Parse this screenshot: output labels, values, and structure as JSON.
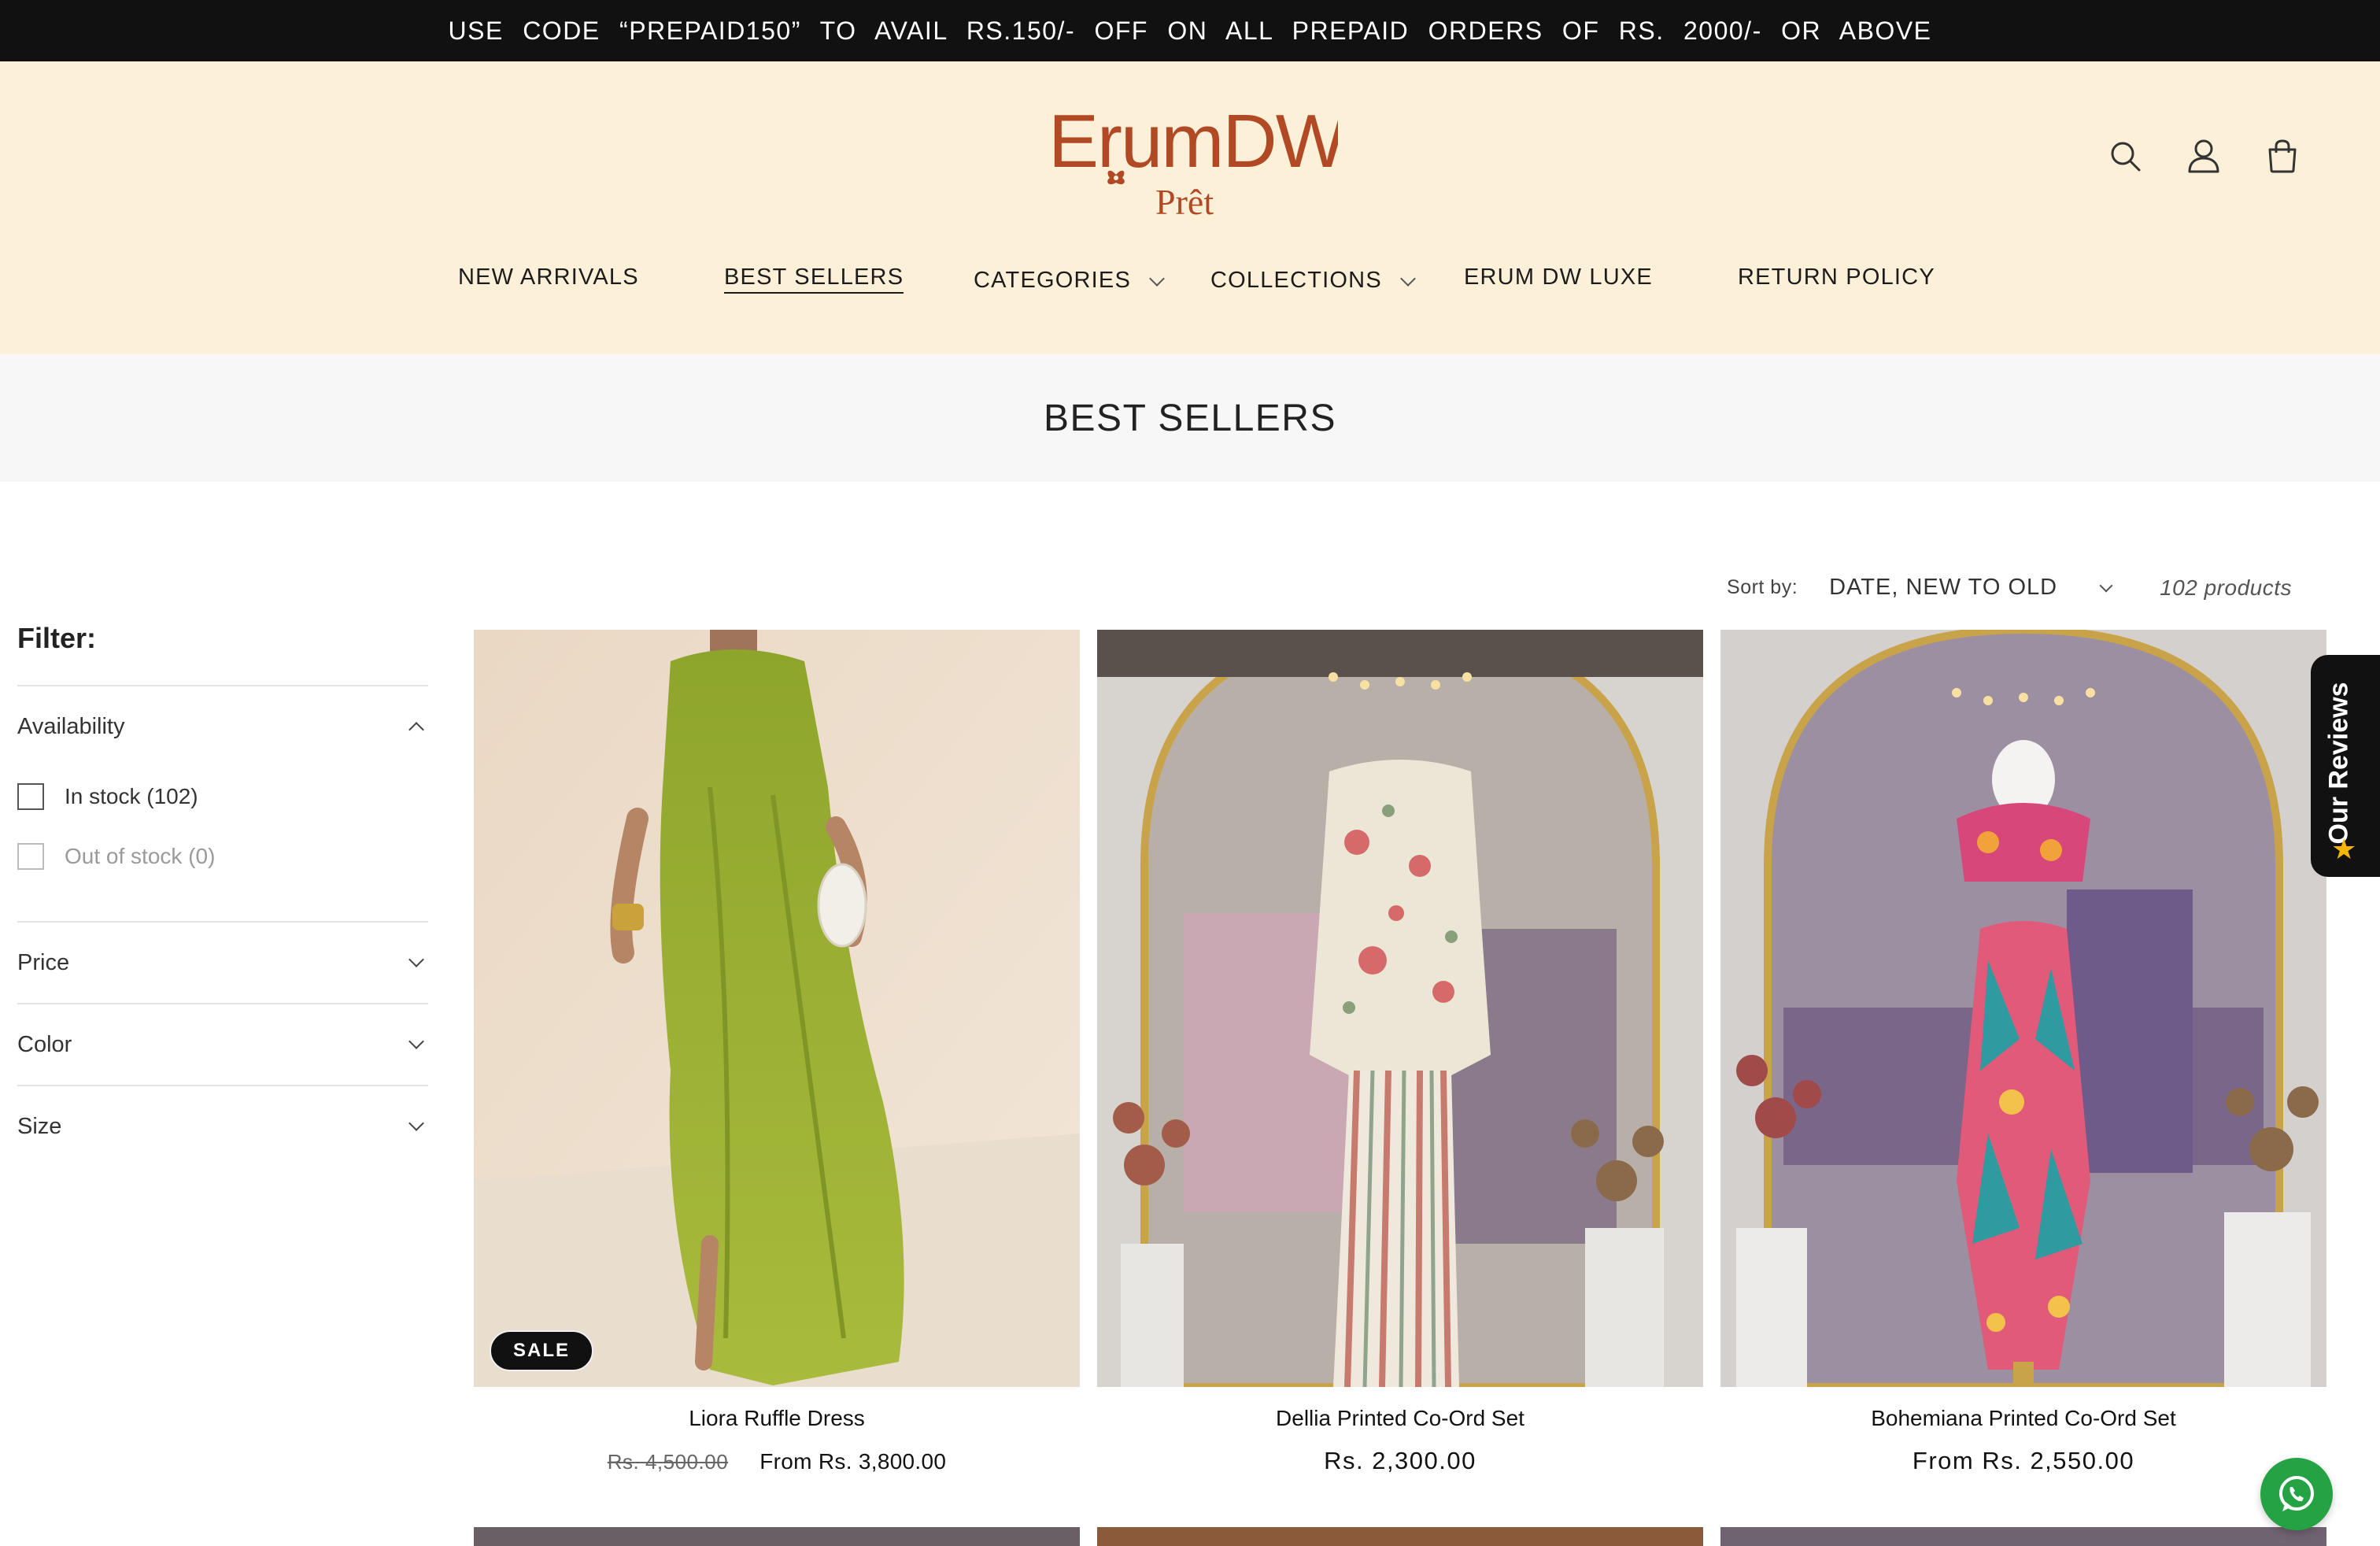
{
  "announcement": "USE CODE “PREPAID150” TO AVAIL RS.150/- OFF ON ALL PREPAID ORDERS OF RS. 2000/- OR ABOVE",
  "brand": {
    "name": "ErumDW",
    "sub": "Prêt",
    "color": "#b14a24"
  },
  "header_icons": [
    "search-icon",
    "account-icon",
    "cart-icon"
  ],
  "nav": [
    {
      "label": "NEW ARRIVALS",
      "dropdown": false
    },
    {
      "label": "BEST SELLERS",
      "dropdown": false,
      "active": true
    },
    {
      "label": "CATEGORIES",
      "dropdown": true
    },
    {
      "label": "COLLECTIONS",
      "dropdown": true
    },
    {
      "label": "ERUM DW LUXE",
      "dropdown": false
    },
    {
      "label": "RETURN POLICY",
      "dropdown": false
    }
  ],
  "page_title": "BEST SELLERS",
  "sort": {
    "label": "Sort by:",
    "value": "DATE, NEW TO OLD"
  },
  "product_count": "102 products",
  "filter": {
    "title": "Filter:",
    "groups": [
      {
        "label": "Availability",
        "open": true,
        "options": [
          {
            "label": "In stock (102)",
            "disabled": false
          },
          {
            "label": "Out of stock (0)",
            "disabled": true
          }
        ]
      },
      {
        "label": "Price",
        "open": false
      },
      {
        "label": "Color",
        "open": false
      },
      {
        "label": "Size",
        "open": false
      }
    ]
  },
  "products": [
    {
      "name": "Liora Ruffle Dress",
      "badge": "SALE",
      "compare_price": "Rs. 4,500.00",
      "price": "From Rs. 3,800.00"
    },
    {
      "name": "Dellia Printed Co-Ord Set",
      "price": "Rs. 2,300.00"
    },
    {
      "name": "Bohemiana Printed Co-Ord Set",
      "price": "From Rs. 2,550.00"
    }
  ],
  "reviews_tab": "Our Reviews",
  "colors": {
    "announcement_bg": "#111111",
    "header_bg": "#fdf0d9",
    "banner_bg": "#f7f7f7",
    "whatsapp": "#25a243"
  }
}
